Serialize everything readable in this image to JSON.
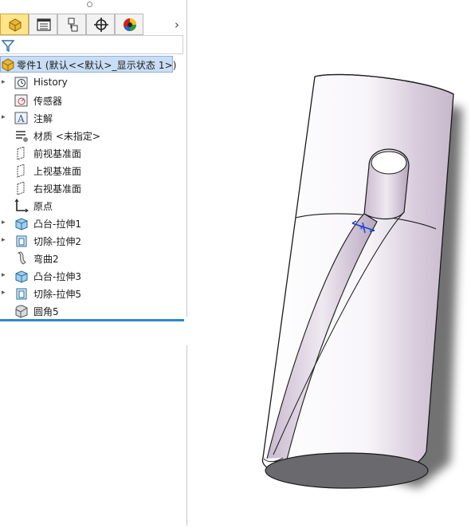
{
  "tree": {
    "root_label": "零件1 (默认<<默认>_显示状态 1>)",
    "items": [
      {
        "label": "History",
        "icon": "history-icon",
        "expandable": true
      },
      {
        "label": "传感器",
        "icon": "sensor-icon",
        "expandable": false
      },
      {
        "label": "注解",
        "icon": "annotation-icon",
        "expandable": true
      },
      {
        "label": "材质 <未指定>",
        "icon": "material-icon",
        "expandable": false
      },
      {
        "label": "前视基准面",
        "icon": "plane-icon",
        "expandable": false
      },
      {
        "label": "上视基准面",
        "icon": "plane-icon",
        "expandable": false
      },
      {
        "label": "右视基准面",
        "icon": "plane-icon",
        "expandable": false
      },
      {
        "label": "原点",
        "icon": "origin-icon",
        "expandable": false
      },
      {
        "label": "凸台-拉伸1",
        "icon": "boss-extrude-icon",
        "expandable": true
      },
      {
        "label": "切除-拉伸2",
        "icon": "cut-extrude-icon",
        "expandable": true
      },
      {
        "label": "弯曲2",
        "icon": "flex-icon",
        "expandable": false
      },
      {
        "label": "凸台-拉伸3",
        "icon": "boss-extrude-icon",
        "expandable": true
      },
      {
        "label": "切除-拉伸5",
        "icon": "cut-extrude-icon",
        "expandable": true
      },
      {
        "label": "圆角5",
        "icon": "fillet-icon",
        "expandable": false
      }
    ]
  },
  "tabs": [
    {
      "icon": "feature-manager-icon",
      "active": true
    },
    {
      "icon": "property-manager-icon",
      "active": false
    },
    {
      "icon": "configuration-manager-icon",
      "active": false
    },
    {
      "icon": "dimxpert-icon",
      "active": false
    },
    {
      "icon": "display-manager-icon",
      "active": false
    }
  ],
  "colors": {
    "accent": "#2f87c8",
    "selection": "#c9def5",
    "active_tab": "#ffe58a"
  }
}
